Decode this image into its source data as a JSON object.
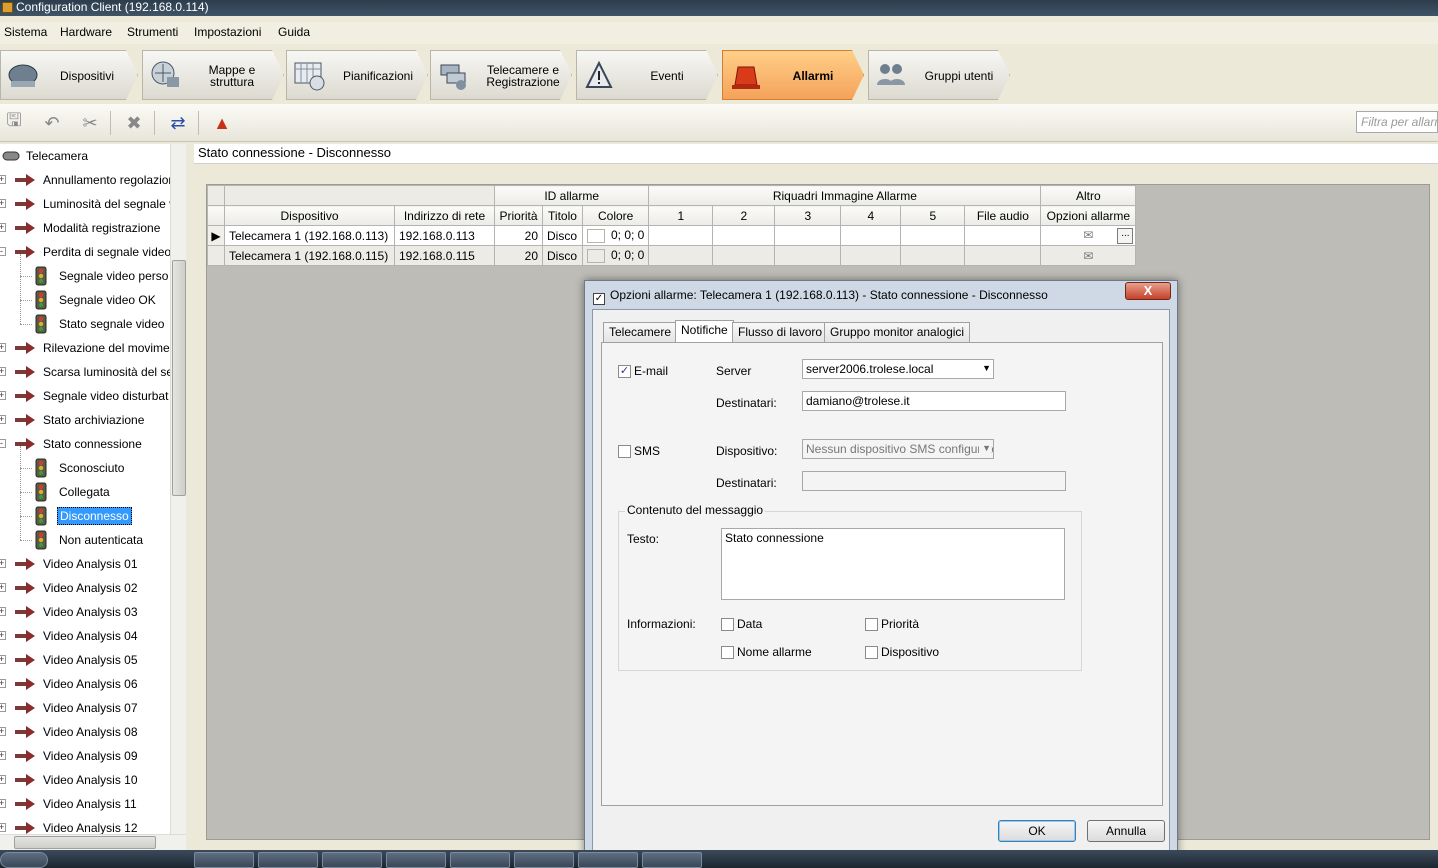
{
  "window": {
    "title": "Configuration Client (192.168.0.114)"
  },
  "menu": [
    "Sistema",
    "Hardware",
    "Strumenti",
    "Impostazioni",
    "Guida"
  ],
  "modules": [
    {
      "label": "Dispositivi",
      "icon": "devices-icon",
      "active": false
    },
    {
      "label": "Mappe e struttura",
      "icon": "maps-icon",
      "active": false
    },
    {
      "label": "Pianificazioni",
      "icon": "schedules-icon",
      "active": false
    },
    {
      "label": "Telecamere e Registrazione",
      "icon": "cameras-icon",
      "active": false
    },
    {
      "label": "Eventi",
      "icon": "events-icon",
      "active": false
    },
    {
      "label": "Allarmi",
      "icon": "alarms-icon",
      "active": true
    },
    {
      "label": "Gruppi utenti",
      "icon": "user-groups-icon",
      "active": false
    }
  ],
  "toolbar": {
    "filter_placeholder": "Filtra per allarm"
  },
  "tree": {
    "root": "Telecamera",
    "items": [
      {
        "label": "Annullamento regolazion",
        "level": 1,
        "icon": "arrow",
        "exp": "+"
      },
      {
        "label": "Luminosità del segnale v",
        "level": 1,
        "icon": "arrow",
        "exp": "+"
      },
      {
        "label": "Modalità registrazione",
        "level": 1,
        "icon": "arrow",
        "exp": "+"
      },
      {
        "label": "Perdita di segnale video",
        "level": 1,
        "icon": "arrow",
        "exp": "-"
      },
      {
        "label": "Segnale video perso",
        "level": 2,
        "icon": "light"
      },
      {
        "label": "Segnale video OK",
        "level": 2,
        "icon": "light"
      },
      {
        "label": "Stato segnale video",
        "level": 2,
        "icon": "light"
      },
      {
        "label": "Rilevazione del movime",
        "level": 1,
        "icon": "arrow",
        "exp": "+"
      },
      {
        "label": "Scarsa luminosità del se",
        "level": 1,
        "icon": "arrow",
        "exp": "+"
      },
      {
        "label": "Segnale video disturbat",
        "level": 1,
        "icon": "arrow",
        "exp": "+"
      },
      {
        "label": "Stato archiviazione",
        "level": 1,
        "icon": "arrow",
        "exp": "+"
      },
      {
        "label": "Stato connessione",
        "level": 1,
        "icon": "arrow",
        "exp": "-"
      },
      {
        "label": "Sconosciuto",
        "level": 2,
        "icon": "light"
      },
      {
        "label": "Collegata",
        "level": 2,
        "icon": "light"
      },
      {
        "label": "Disconnesso",
        "level": 2,
        "icon": "light",
        "selected": true
      },
      {
        "label": "Non autenticata",
        "level": 2,
        "icon": "light"
      },
      {
        "label": "Video Analysis 01",
        "level": 1,
        "icon": "arrow",
        "exp": "+"
      },
      {
        "label": "Video Analysis 02",
        "level": 1,
        "icon": "arrow",
        "exp": "+"
      },
      {
        "label": "Video Analysis 03",
        "level": 1,
        "icon": "arrow",
        "exp": "+"
      },
      {
        "label": "Video Analysis 04",
        "level": 1,
        "icon": "arrow",
        "exp": "+"
      },
      {
        "label": "Video Analysis 05",
        "level": 1,
        "icon": "arrow",
        "exp": "+"
      },
      {
        "label": "Video Analysis 06",
        "level": 1,
        "icon": "arrow",
        "exp": "+"
      },
      {
        "label": "Video Analysis 07",
        "level": 1,
        "icon": "arrow",
        "exp": "+"
      },
      {
        "label": "Video Analysis 08",
        "level": 1,
        "icon": "arrow",
        "exp": "+"
      },
      {
        "label": "Video Analysis 09",
        "level": 1,
        "icon": "arrow",
        "exp": "+"
      },
      {
        "label": "Video Analysis 10",
        "level": 1,
        "icon": "arrow",
        "exp": "+"
      },
      {
        "label": "Video Analysis 11",
        "level": 1,
        "icon": "arrow",
        "exp": "+"
      },
      {
        "label": "Video Analysis 12",
        "level": 1,
        "icon": "arrow",
        "exp": "+"
      }
    ]
  },
  "main": {
    "header": "Stato connessione - Disconnesso"
  },
  "grid": {
    "group_headers": {
      "id": "ID allarme",
      "riquadri": "Riquadri Immagine Allarme",
      "altro": "Altro"
    },
    "columns": [
      "Dispositivo",
      "Indirizzo di rete",
      "Priorità",
      "Titolo",
      "Colore",
      "1",
      "2",
      "3",
      "4",
      "5",
      "File audio",
      "Opzioni allarme"
    ],
    "rows": [
      {
        "device": "Telecamera 1 (192.168.0.113)",
        "address": "192.168.0.113",
        "priority": "20",
        "title": "Disco",
        "color": "0; 0; 0"
      },
      {
        "device": "Telecamera 1 (192.168.0.115)",
        "address": "192.168.0.115",
        "priority": "20",
        "title": "Disco",
        "color": "0; 0; 0"
      }
    ],
    "ellipsis": "..."
  },
  "dialog": {
    "title": "Opzioni allarme: Telecamera 1 (192.168.0.113) - Stato connessione - Disconnesso",
    "close": "X",
    "tabs": [
      "Telecamere",
      "Notifiche",
      "Flusso di lavoro",
      "Gruppo monitor analogici"
    ],
    "email_label": "E-mail",
    "email_checked": true,
    "server_label": "Server",
    "server_value": "server2006.trolese.local",
    "recipients_label": "Destinatari:",
    "email_recipients": "damiano@trolese.it",
    "sms_label": "SMS",
    "sms_checked": false,
    "device_label": "Dispositivo:",
    "sms_device_value": "Nessun dispositivo SMS configurato",
    "sms_recipients": "",
    "content_group": "Contenuto del messaggio",
    "text_label": "Testo:",
    "text_value": "Stato connessione",
    "info_label": "Informazioni:",
    "info_options": [
      "Data",
      "Priorità",
      "Nome allarme",
      "Dispositivo"
    ],
    "ok": "OK",
    "cancel": "Annulla"
  }
}
